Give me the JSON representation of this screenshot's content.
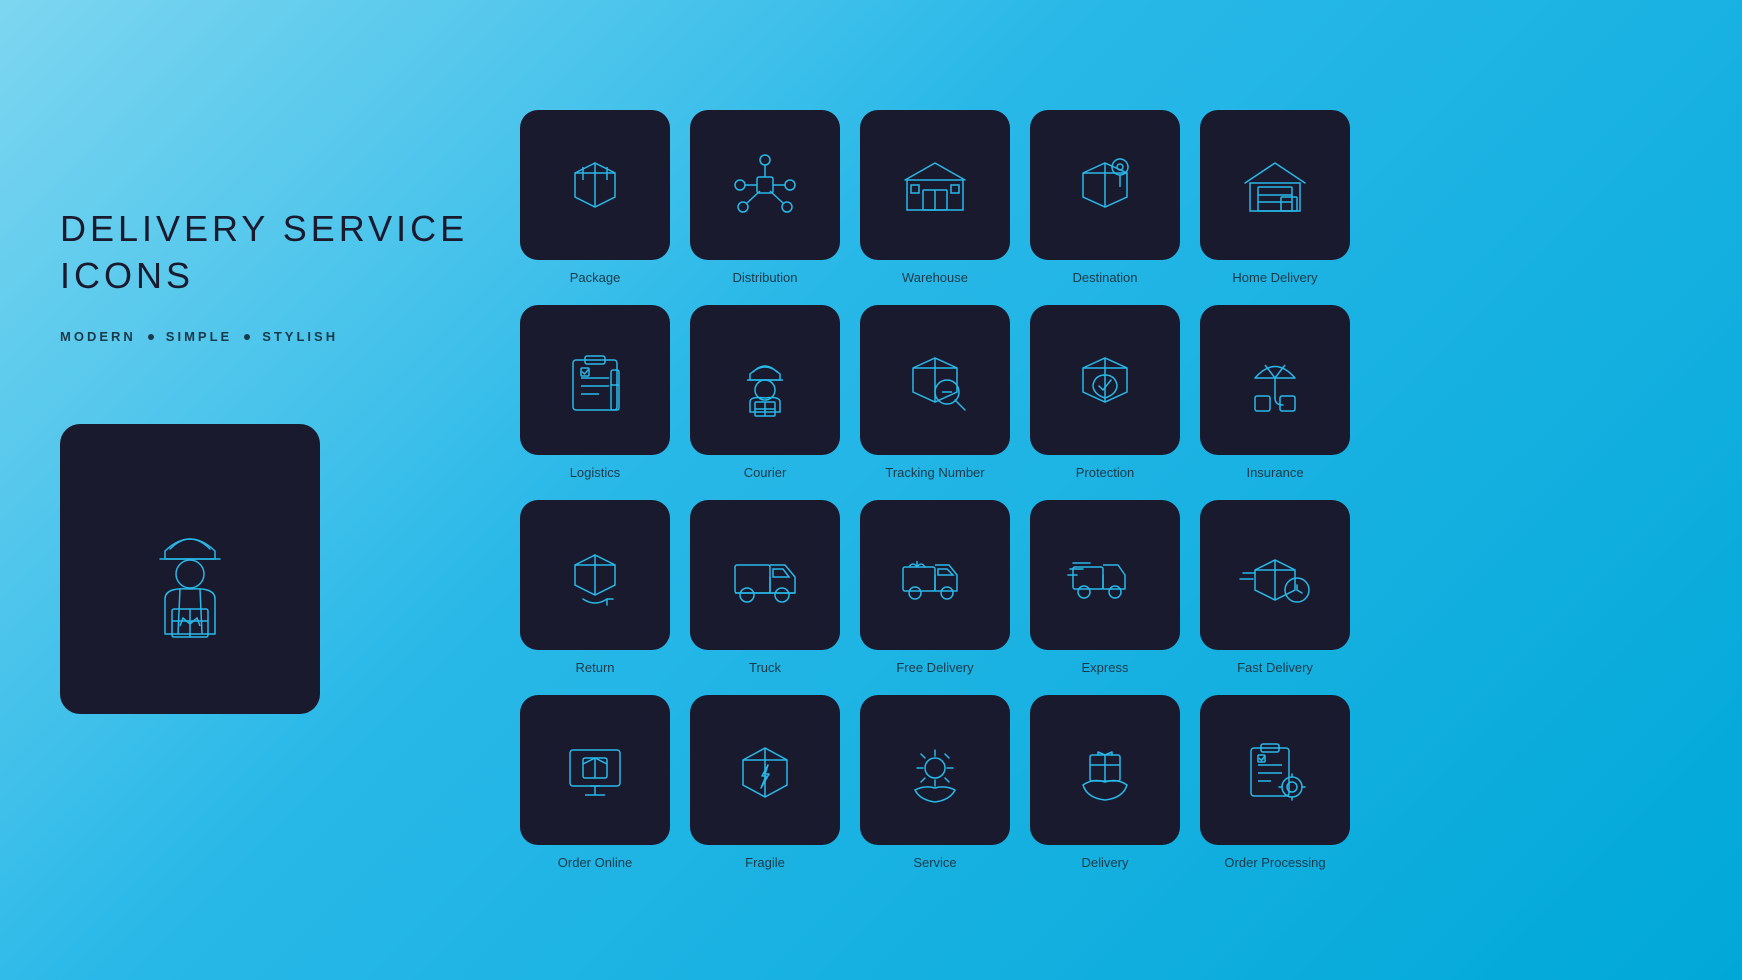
{
  "header": {
    "title_line1": "DELIVERY SERVICE",
    "title_line2": "ICONS",
    "subtitle": [
      "MODERN",
      "SIMPLE",
      "STYLISH"
    ]
  },
  "icons": {
    "row1": [
      {
        "label": "Package"
      },
      {
        "label": "Distribution"
      },
      {
        "label": "Warehouse"
      },
      {
        "label": "Destination"
      },
      {
        "label": "Home Delivery"
      }
    ],
    "row2": [
      {
        "label": "Logistics"
      },
      {
        "label": "Courier"
      },
      {
        "label": "Tracking Number"
      },
      {
        "label": "Protection"
      },
      {
        "label": "Insurance"
      }
    ],
    "row3": [
      {
        "label": "Return"
      },
      {
        "label": "Truck"
      },
      {
        "label": "Free Delivery"
      },
      {
        "label": "Express"
      },
      {
        "label": "Fast Delivery"
      }
    ],
    "row4": [
      {
        "label": "Order Online"
      },
      {
        "label": "Fragile"
      },
      {
        "label": "Service"
      },
      {
        "label": "Delivery"
      },
      {
        "label": "Order Processing"
      }
    ]
  },
  "colors": {
    "bg_start": "#7dd6f0",
    "bg_end": "#00a8d8",
    "icon_bg": "#1a1a2e",
    "icon_stroke": "#29b8e8",
    "text_dark": "#1a3a4a"
  }
}
